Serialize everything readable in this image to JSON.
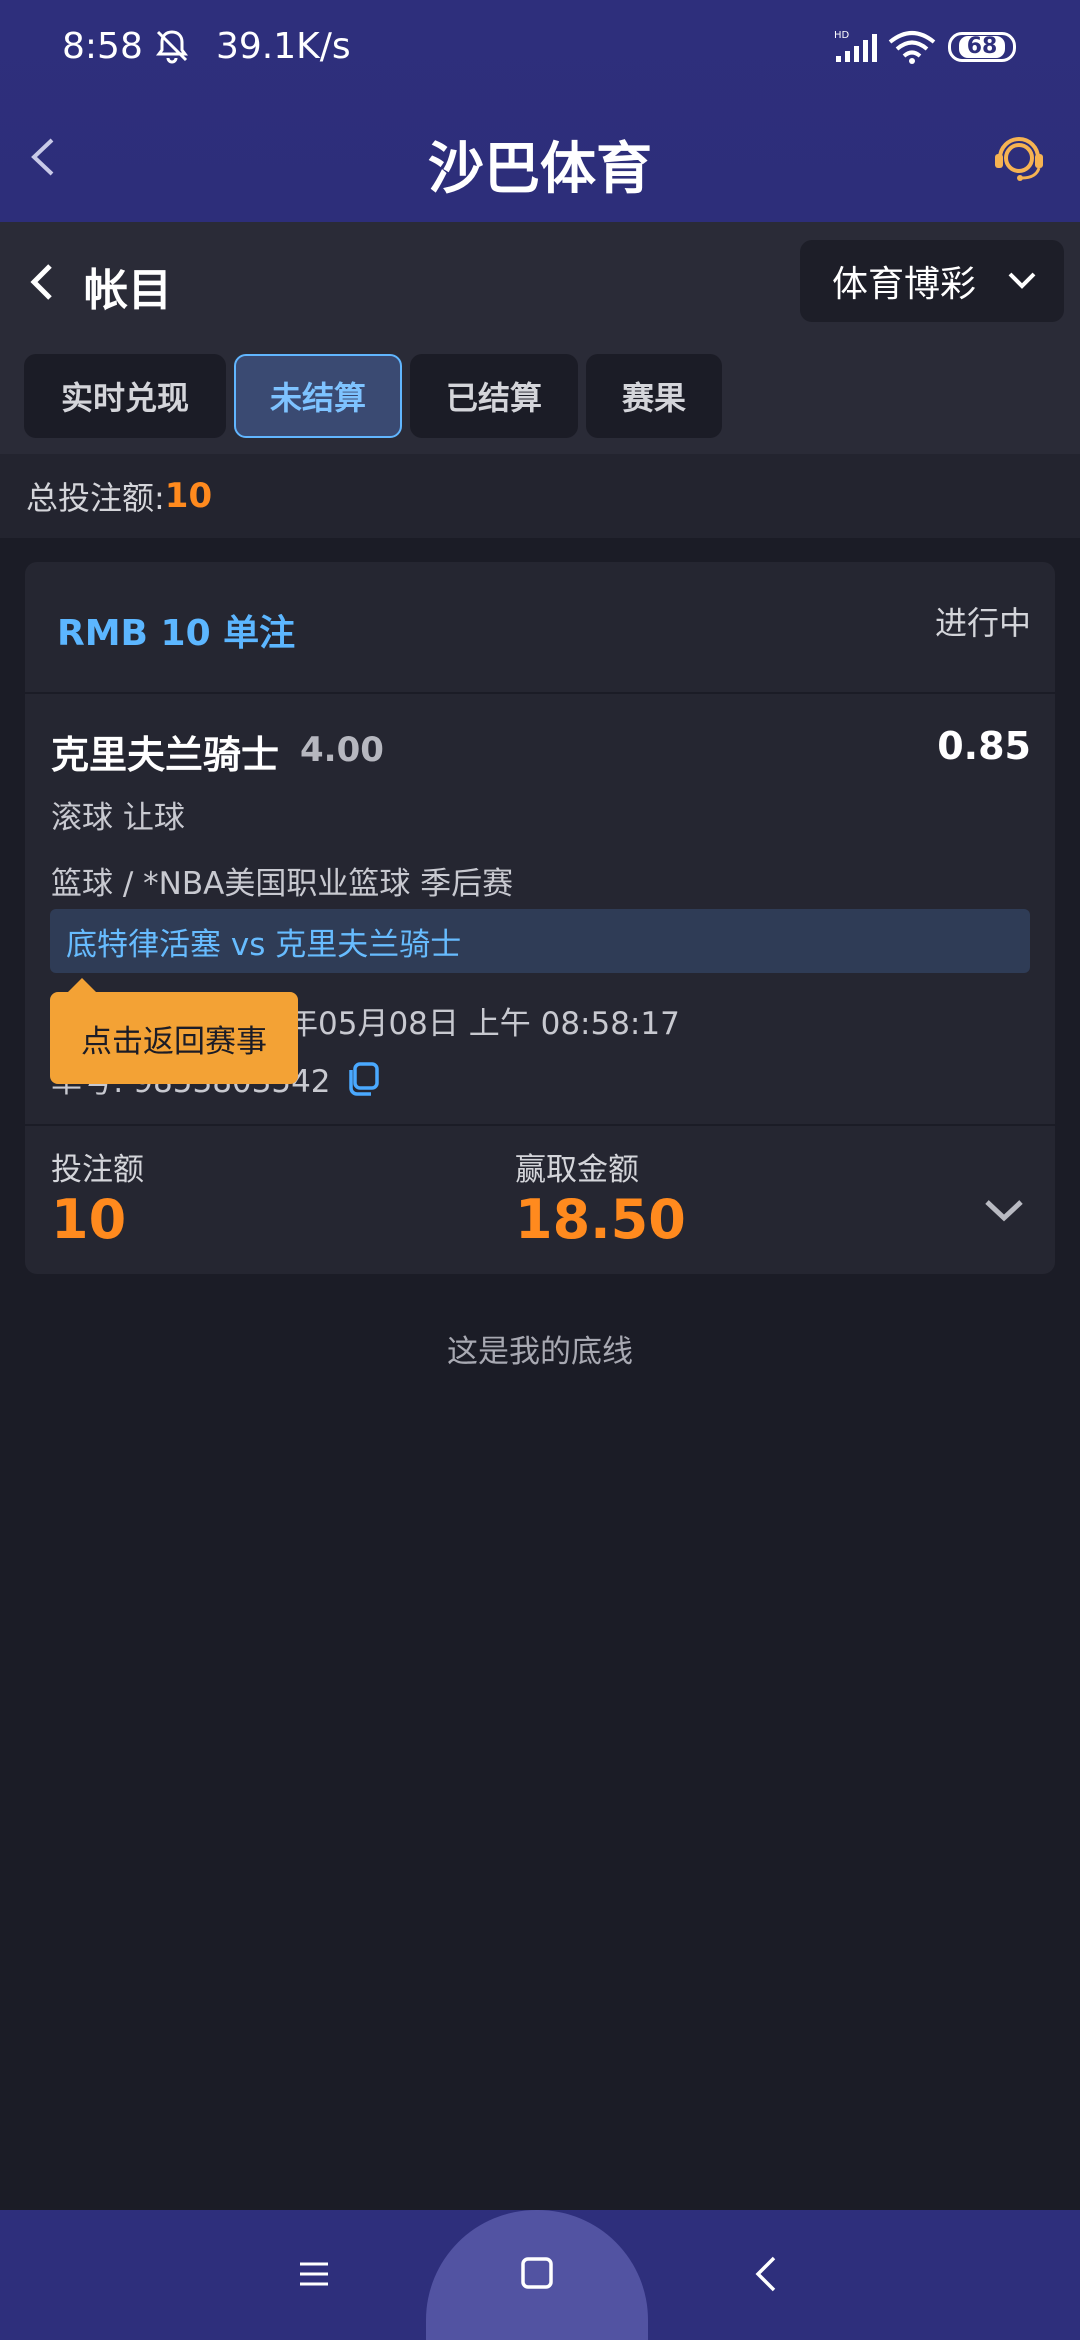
{
  "status_bar": {
    "time": "8:58",
    "net_speed": "39.1K/s",
    "signal_label": "HD",
    "battery": "68"
  },
  "app_bar": {
    "title": "沙巴体育"
  },
  "account": {
    "title": "帐目",
    "sport_dropdown": "体育博彩",
    "tabs": [
      {
        "label": "实时兑现",
        "active": false
      },
      {
        "label": "未结算",
        "active": true
      },
      {
        "label": "已结算",
        "active": false
      },
      {
        "label": "赛果",
        "active": false
      }
    ],
    "total_label": "总投注额:",
    "total_value": "10"
  },
  "bet": {
    "title": "RMB 10 单注",
    "status": "进行中",
    "selection": "克里夫兰骑士",
    "odds": "4.00",
    "handicap": "0.85",
    "bet_type": "滚球 让球",
    "league": "篮球 / *NBA美国职业篮球 季后赛",
    "match": "底特律活塞 vs 克里夫兰骑士",
    "time_visible": "年05月08日 上午 08:58:17",
    "ticket_visible": "单号: 9853803542",
    "tooltip": "点击返回赛事",
    "stake_label": "投注额",
    "stake_value": "10",
    "win_label": "赢取金额",
    "win_value": "18.50"
  },
  "footer_note": "这是我的底线",
  "colors": {
    "header": "#2e2f7c",
    "accent_blue": "#5cb6ff",
    "accent_orange": "#ff8a1e",
    "tooltip": "#f3a235"
  }
}
